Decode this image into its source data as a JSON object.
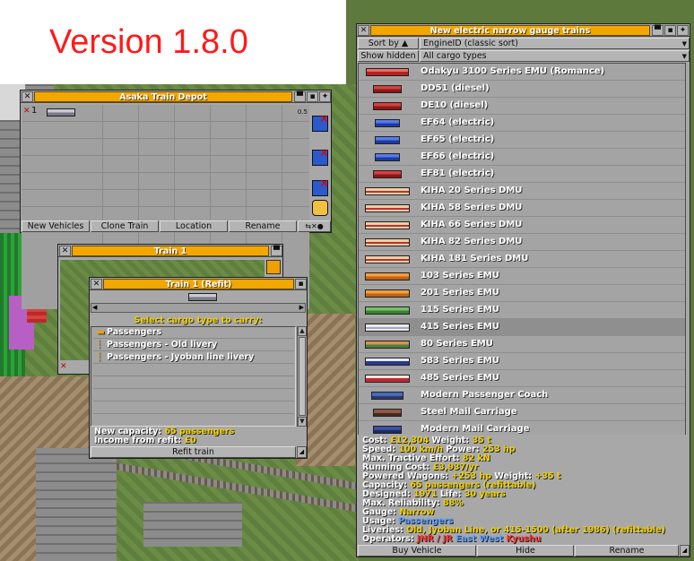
{
  "version_label": "Version 1.8.0",
  "depot": {
    "title": "Asaka Train Depot",
    "train_number": "1",
    "train_age": "0.5",
    "buttons": {
      "new_vehicles": "New Vehicles",
      "clone_train": "Clone Train",
      "location": "Location",
      "rename": "Rename"
    }
  },
  "train_window": {
    "title": "Train 1"
  },
  "refit": {
    "title": "Train 1 (Refit)",
    "prompt": "Select cargo type to carry:",
    "cargo_options": [
      {
        "label": "Passengers",
        "selected": true
      },
      {
        "label": "Passengers - Old livery",
        "selected": false
      },
      {
        "label": "Passengers - Jyoban line livery",
        "selected": false
      }
    ],
    "new_capacity_label": "New capacity: ",
    "new_capacity_value": "65 passengers",
    "income_label": "Income from refit: ",
    "income_value": "£0",
    "refit_button": "Refit train"
  },
  "buy_window": {
    "title": "New electric narrow gauge trains",
    "sort_by_label": "Sort by ▲",
    "sort_value": "EngineID (classic sort)",
    "show_hidden_label": "Show hidden",
    "cargo_filter": "All cargo types",
    "engines": [
      {
        "name": "Odakyu 3100 Series EMU (Romance)",
        "sprite": "rc"
      },
      {
        "name": "DD51 (diesel)",
        "sprite": "red"
      },
      {
        "name": "DE10 (diesel)",
        "sprite": "red"
      },
      {
        "name": "EF64 (electric)",
        "sprite": "blue"
      },
      {
        "name": "EF65 (electric)",
        "sprite": "blue"
      },
      {
        "name": "EF66 (electric)",
        "sprite": "blue"
      },
      {
        "name": "EF81 (electric)",
        "sprite": "red"
      },
      {
        "name": "KIHA 20 Series DMU",
        "sprite": "kiha"
      },
      {
        "name": "KIHA 58 Series DMU",
        "sprite": "kiha"
      },
      {
        "name": "KIHA 66 Series DMU",
        "sprite": "kiha"
      },
      {
        "name": "KIHA 82 Series DMU",
        "sprite": "kiha"
      },
      {
        "name": "KIHA 181 Series DMU",
        "sprite": "kiha"
      },
      {
        "name": "103 Series EMU",
        "sprite": "orange"
      },
      {
        "name": "201 Series EMU",
        "sprite": "orange"
      },
      {
        "name": "115 Series EMU",
        "sprite": "green"
      },
      {
        "name": "415 Series EMU",
        "sprite": "415"
      },
      {
        "name": "80 Series EMU",
        "sprite": "80"
      },
      {
        "name": "583 Series EMU",
        "sprite": "583"
      },
      {
        "name": "485 Series EMU",
        "sprite": "485"
      },
      {
        "name": "Modern Passenger Coach",
        "sprite": "coach"
      },
      {
        "name": "Steel Mail Carriage",
        "sprite": "mail"
      },
      {
        "name": "Modern Mail Carriage",
        "sprite": "mmail"
      }
    ],
    "selected_index": 15,
    "details": {
      "cost_label": "Cost: ",
      "cost_value": "£12,304",
      "weight_label": " Weight: ",
      "weight_value": "35 t",
      "speed_label": "Speed: ",
      "speed_value": "100 km/h",
      "power_label": " Power: ",
      "power_value": "253 hp",
      "tractive_label": "Max. Tractive Effort: ",
      "tractive_value": "82 kN",
      "running_label": "Running Cost: ",
      "running_value": "£3,937/yr",
      "powered_label": "Powered Wagons: ",
      "powered_value": "+253 hp",
      "powered_weight_label": " Weight: ",
      "powered_weight_value": "+35 t",
      "capacity_label": "Capacity: ",
      "capacity_value": "65 passengers (refittable)",
      "designed_label": "Designed: ",
      "designed_value": "1971",
      "life_label": " Life: ",
      "life_value": "30 years",
      "reliability_label": "Max. Reliability: ",
      "reliability_value": "88%",
      "gauge_label": "Gauge: ",
      "gauge_value": "Narrow",
      "usage_label": "Usage: ",
      "usage_value": "Passengers",
      "liveries_label": "Liveries: ",
      "liveries_value": "Old, Jyoban Line, or 415-1500 (after 1986) (refittable)",
      "operators_label": "Operators: ",
      "operators_jnr": "JNR / JR",
      "operators_east": "East",
      "operators_west": "West",
      "operators_kyushu": "Kyushu"
    },
    "buttons": {
      "buy": "Buy Vehicle",
      "hide": "Hide",
      "rename": "Rename"
    }
  },
  "colors": {
    "caption_orange": "#f2a700",
    "value_yellow": "#f0d000",
    "version_red": "#ff1a1a"
  }
}
